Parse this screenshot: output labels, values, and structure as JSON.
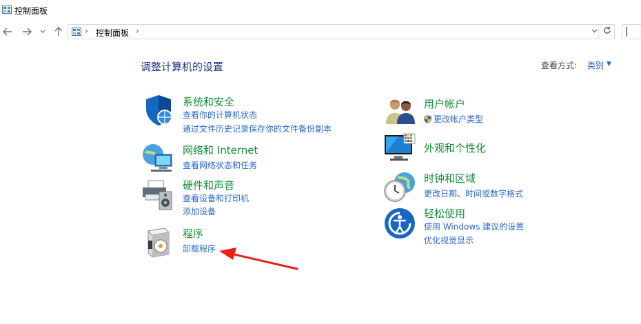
{
  "window": {
    "title": "控制面板"
  },
  "nav": {
    "breadcrumb": [
      "控制面板"
    ],
    "back_icon": "arrow-left-icon",
    "forward_icon": "arrow-right-icon",
    "recent_icon": "chevron-down-icon",
    "up_icon": "arrow-up-icon",
    "refresh_icon": "refresh-icon"
  },
  "main": {
    "heading": "调整计算机的设置",
    "view_by_label": "查看方式:",
    "view_by_value": "类别"
  },
  "categories_left": [
    {
      "title": "系统和安全",
      "icon": "shield-icon",
      "links": [
        "查看你的计算机状态",
        "通过文件历史记录保存你的文件备份副本"
      ]
    },
    {
      "title": "网络和 Internet",
      "icon": "network-globe-icon",
      "links": [
        "查看网络状态和任务"
      ]
    },
    {
      "title": "硬件和声音",
      "icon": "printer-speaker-icon",
      "links": [
        "查看设备和打印机",
        "添加设备"
      ]
    },
    {
      "title": "程序",
      "icon": "programs-disc-icon",
      "links": [
        "卸载程序"
      ]
    }
  ],
  "categories_right": [
    {
      "title": "用户帐户",
      "icon": "users-icon",
      "links": [
        "更改帐户类型"
      ]
    },
    {
      "title": "外观和个性化",
      "icon": "monitor-palette-icon",
      "links": []
    },
    {
      "title": "时钟和区域",
      "icon": "clock-globe-icon",
      "links": [
        "更改日期、时间或数字格式"
      ]
    },
    {
      "title": "轻松使用",
      "icon": "ease-of-access-icon",
      "links": [
        "使用 Windows 建议的设置",
        "优化视觉显示"
      ]
    }
  ],
  "annotation": {
    "color": "#e8201a",
    "target": "卸载程序"
  },
  "colors": {
    "link": "#2a68c8",
    "category_title": "#138a3a",
    "heading": "#1e3287"
  }
}
